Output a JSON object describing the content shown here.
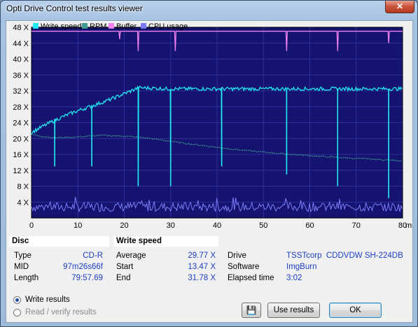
{
  "window": {
    "title": "Opti Drive Control test results viewer",
    "close_glyph": "✕"
  },
  "legend": [
    {
      "label": "Write speed",
      "color": "#22e6f0"
    },
    {
      "label": "RPM",
      "color": "#3d9b8f"
    },
    {
      "label": "Buffer",
      "color": "#f07ff0"
    },
    {
      "label": "CPU usage",
      "color": "#7c7cf8"
    }
  ],
  "chart_data": {
    "type": "line",
    "background": "#141470",
    "grid": true,
    "xlabel": "min",
    "xlim": [
      0,
      80
    ],
    "ylim": [
      0,
      48
    ],
    "x_ticks": [
      "0",
      "10",
      "20",
      "30",
      "40",
      "50",
      "60",
      "70",
      "80"
    ],
    "y_ticks": [
      "4 X",
      "8 X",
      "12 X",
      "16 X",
      "20 X",
      "24 X",
      "28 X",
      "32 X",
      "36 X",
      "40 X",
      "44 X",
      "48 X"
    ],
    "series": [
      {
        "name": "Write speed",
        "color": "#22e6f0",
        "x": [
          0,
          2,
          4,
          6,
          8,
          10,
          12,
          14,
          16,
          18,
          20,
          21.5,
          22.5,
          23,
          30,
          40,
          50,
          60,
          70,
          80
        ],
        "y": [
          21.5,
          22.8,
          24.0,
          25.1,
          26.1,
          27.0,
          27.8,
          28.6,
          29.4,
          30.3,
          31.3,
          32.0,
          32.5,
          32.8,
          32.5,
          32.5,
          32.5,
          32.5,
          32.5,
          32.5
        ],
        "dips": [
          {
            "x": 5,
            "y": 13
          },
          {
            "x": 13,
            "y": 13
          },
          {
            "x": 23,
            "y": 8
          },
          {
            "x": 30,
            "y": 8
          },
          {
            "x": 41,
            "y": 13
          },
          {
            "x": 55,
            "y": 11
          },
          {
            "x": 66,
            "y": 8
          },
          {
            "x": 77,
            "y": 5
          }
        ]
      },
      {
        "name": "RPM",
        "color": "#3d9b8f",
        "x": [
          0,
          2,
          5,
          10,
          15,
          20,
          25,
          30,
          35,
          40,
          45,
          50,
          55,
          60,
          65,
          70,
          75,
          80
        ],
        "y": [
          21.0,
          20.6,
          20.2,
          20.4,
          20.8,
          20.6,
          20.1,
          19.3,
          18.5,
          17.8,
          17.1,
          16.6,
          16.1,
          15.7,
          15.3,
          15.0,
          14.7,
          14.4
        ]
      },
      {
        "name": "Buffer",
        "color": "#f07ff0",
        "x": [
          0,
          80
        ],
        "y": [
          47.0,
          47.0
        ],
        "dips": [
          {
            "x": 19,
            "y": 45
          },
          {
            "x": 23,
            "y": 42
          },
          {
            "x": 31,
            "y": 42
          },
          {
            "x": 55,
            "y": 42
          },
          {
            "x": 66,
            "y": 42
          },
          {
            "x": 77,
            "y": 44
          }
        ]
      },
      {
        "name": "CPU usage",
        "color": "#7c7cf8",
        "baseline": 2.8,
        "amplitude": 1.2,
        "peak_max": 5.5
      }
    ]
  },
  "disc": {
    "heading": "Disc",
    "rows": [
      {
        "label": "Type",
        "value": "CD-R"
      },
      {
        "label": "MID",
        "value": "97m26s66f"
      },
      {
        "label": "Length",
        "value": "79:57.69"
      }
    ]
  },
  "write_speed": {
    "heading": "Write speed",
    "rows": [
      {
        "label": "Average",
        "value": "29.77 X"
      },
      {
        "label": "Start",
        "value": "13.47 X"
      },
      {
        "label": "End",
        "value": "31.78 X"
      }
    ]
  },
  "info": {
    "rows": [
      {
        "label": "Drive",
        "value": "TSSTcorp  CDDVDW SH-224DB"
      },
      {
        "label": "Software",
        "value": "ImgBurn"
      },
      {
        "label": "Elapsed time",
        "value": "3:02"
      }
    ]
  },
  "options": [
    {
      "label": "Write results",
      "selected": true,
      "enabled": true
    },
    {
      "label": "Read / verify results",
      "selected": false,
      "enabled": false
    }
  ],
  "buttons": {
    "save_glyph": "💾",
    "use_results": "Use results",
    "ok": "OK"
  }
}
